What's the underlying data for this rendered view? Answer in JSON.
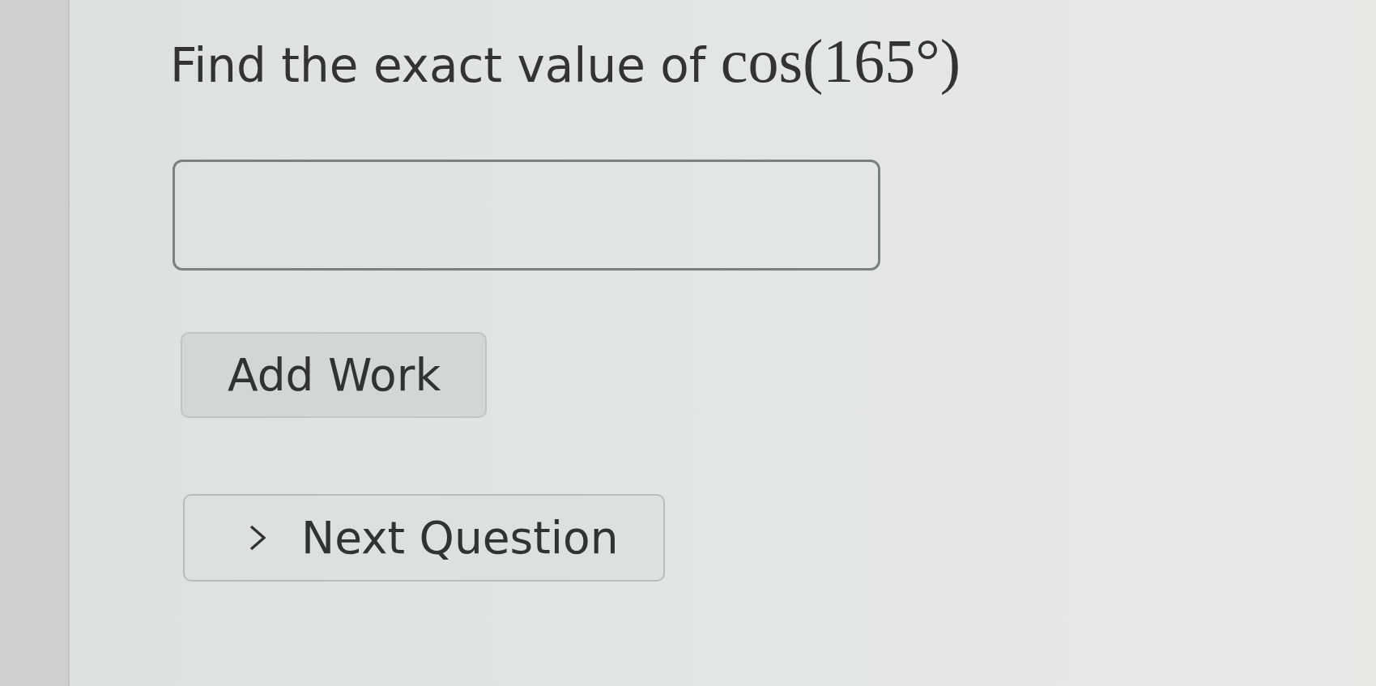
{
  "question": {
    "prompt": "Find the exact value of",
    "expression": "cos(165°)"
  },
  "answer_field": {
    "kind": "text"
  },
  "buttons": [
    {
      "label": "Add Work",
      "kind": "work"
    },
    {
      "label": "Next Question",
      "kind": "next"
    }
  ]
}
